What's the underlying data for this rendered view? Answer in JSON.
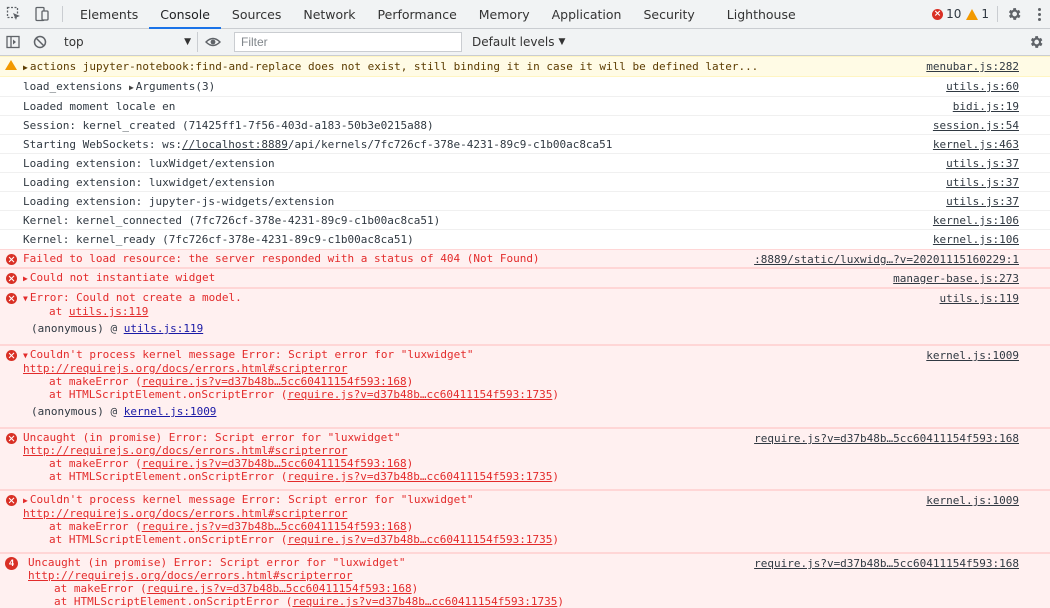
{
  "tabbar": {
    "tabs": [
      "Elements",
      "Console",
      "Sources",
      "Network",
      "Performance",
      "Memory",
      "Application",
      "Security",
      "Lighthouse"
    ],
    "active_index": 1,
    "error_count": "10",
    "warning_count": "1"
  },
  "toolbar": {
    "context": "top",
    "filter_placeholder": "Filter",
    "levels": "Default levels"
  },
  "messages": {
    "m0": {
      "text": "actions jupyter-notebook:find-and-replace does not exist, still binding it in case it will be defined later...",
      "source": "menubar.js:282"
    },
    "m1": {
      "text_a": "load_extensions",
      "text_b": "Arguments(3)",
      "source": "utils.js:60"
    },
    "m2": {
      "text": "Loaded moment locale en",
      "source": "bidi.js:19"
    },
    "m3": {
      "text": "Session: kernel_created (71425ff1-7f56-403d-a183-50b3e0215a88)",
      "source": "session.js:54"
    },
    "m4": {
      "text_a": "Starting WebSockets: ws:",
      "text_b": "//localhost:8889",
      "text_c": "/api/kernels/7fc726cf-378e-4231-89c9-c1b00ac8ca51",
      "source": "kernel.js:463"
    },
    "m5": {
      "text": "Loading extension: luxWidget/extension",
      "source": "utils.js:37"
    },
    "m6": {
      "text": "Loading extension: luxwidget/extension",
      "source": "utils.js:37"
    },
    "m7": {
      "text": "Loading extension: jupyter-js-widgets/extension",
      "source": "utils.js:37"
    },
    "m8": {
      "text": "Kernel: kernel_connected (7fc726cf-378e-4231-89c9-c1b00ac8ca51)",
      "source": "kernel.js:106"
    },
    "m9": {
      "text": "Kernel: kernel_ready (7fc726cf-378e-4231-89c9-c1b00ac8ca51)",
      "source": "kernel.js:106"
    },
    "e0": {
      "text": "Failed to load resource: the server responded with a status of 404 (Not Found)",
      "source": ":8889/static/luxwidg…?v=20201115160229:1"
    },
    "e1": {
      "text": "Could not instantiate widget",
      "source": "manager-base.js:273"
    },
    "e2": {
      "text": "Error: Could not create a model.",
      "at_prefix": "at ",
      "at_link": "utils.js:119",
      "anon_prefix": "(anonymous) @ ",
      "anon_link": "utils.js:119",
      "source": "utils.js:119"
    },
    "e3": {
      "text": "Couldn't process kernel message Error: Script error for \"luxwidget\"",
      "url": "http://requirejs.org/docs/errors.html#scripterror",
      "l1_prefix": "at makeError (",
      "l1_link": "require.js?v=d37b48b…5cc60411154f593:168",
      "l1_suffix": ")",
      "l2_prefix": "at HTMLScriptElement.onScriptError (",
      "l2_link": "require.js?v=d37b48b…cc60411154f593:1735",
      "l2_suffix": ")",
      "anon_prefix": "(anonymous) @ ",
      "anon_link": "kernel.js:1009",
      "source": "kernel.js:1009"
    },
    "e4": {
      "text": "Uncaught (in promise) Error: Script error for \"luxwidget\"",
      "url": "http://requirejs.org/docs/errors.html#scripterror",
      "l1_prefix": "at makeError (",
      "l1_link": "require.js?v=d37b48b…5cc60411154f593:168",
      "l1_suffix": ")",
      "l2_prefix": "at HTMLScriptElement.onScriptError (",
      "l2_link": "require.js?v=d37b48b…cc60411154f593:1735",
      "l2_suffix": ")",
      "source": "require.js?v=d37b48b…5cc60411154f593:168"
    },
    "e5": {
      "text": "Couldn't process kernel message Error: Script error for \"luxwidget\"",
      "url": "http://requirejs.org/docs/errors.html#scripterror",
      "l1_prefix": "at makeError (",
      "l1_link": "require.js?v=d37b48b…5cc60411154f593:168",
      "l1_suffix": ")",
      "l2_prefix": "at HTMLScriptElement.onScriptError (",
      "l2_link": "require.js?v=d37b48b…cc60411154f593:1735",
      "l2_suffix": ")",
      "source": "kernel.js:1009"
    },
    "e6": {
      "badge": "4",
      "text": "Uncaught (in promise) Error: Script error for \"luxwidget\"",
      "url": "http://requirejs.org/docs/errors.html#scripterror",
      "l1_prefix": "at makeError (",
      "l1_link": "require.js?v=d37b48b…5cc60411154f593:168",
      "l1_suffix": ")",
      "l2_prefix": "at HTMLScriptElement.onScriptError (",
      "l2_link": "require.js?v=d37b48b…cc60411154f593:1735",
      "l2_suffix": ")",
      "source": "require.js?v=d37b48b…5cc60411154f593:168"
    }
  },
  "colors": {
    "accent": "#1a73e8",
    "error": "#d93025",
    "warning": "#f29900",
    "error_bg": "#fff0f0",
    "warning_bg": "#fffbe5"
  }
}
